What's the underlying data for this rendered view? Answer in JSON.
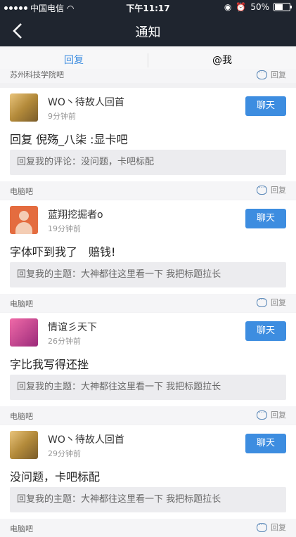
{
  "status_bar": {
    "carrier": "中国电信",
    "time": "下午11:17",
    "battery": "50%"
  },
  "navbar": {
    "title": "通知"
  },
  "tabs": [
    {
      "label": "回复"
    },
    {
      "label": "@我"
    }
  ],
  "top_header": {
    "forum": "苏州科技学院吧",
    "reply": "回复"
  },
  "items": [
    {
      "user": "WO丶待故人回首",
      "time": "9分钟前",
      "button": "聊天",
      "content": "回复 倪殇_八柒 :显卡吧",
      "quote": "回复我的评论：没问题，卡吧标配",
      "forum": "电脑吧",
      "reply": "回复"
    },
    {
      "user": "蓝翔挖掘者o",
      "time": "19分钟前",
      "button": "聊天",
      "content": "字体吓到我了　赔钱!",
      "quote": "回复我的主题：大神都往这里看一下 我把标题拉长",
      "forum": "电脑吧",
      "reply": "回复"
    },
    {
      "user": "情谊彡天下",
      "time": "26分钟前",
      "button": "聊天",
      "content": "字比我写得还挫",
      "quote": "回复我的主题：大神都往这里看一下 我把标题拉长",
      "forum": "电脑吧",
      "reply": "回复"
    },
    {
      "user": "WO丶待故人回首",
      "time": "29分钟前",
      "button": "聊天",
      "content": "没问题，卡吧标配",
      "quote": "回复我的主题：大神都往这里看一下 我把标题拉长",
      "forum": "电脑吧",
      "reply": "回复"
    }
  ]
}
